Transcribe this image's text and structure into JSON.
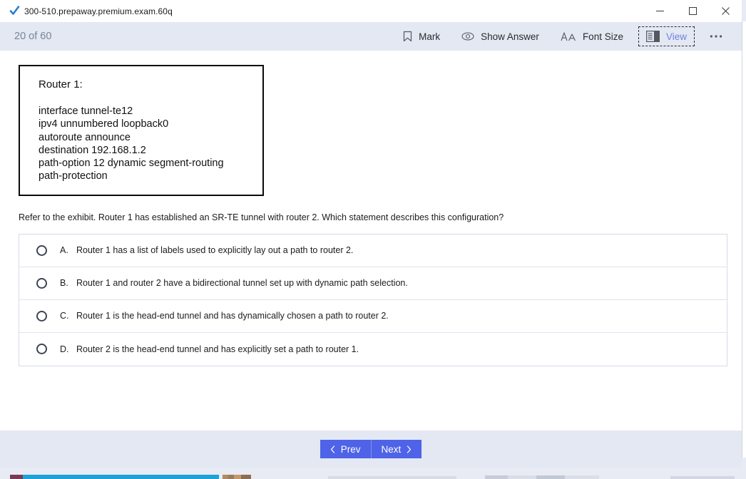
{
  "window": {
    "title": "300-510.prepaway.premium.exam.60q",
    "app_icon": "checkmark-icon",
    "controls": {
      "minimize": "minimize-icon",
      "maximize": "maximize-icon",
      "close": "close-icon"
    }
  },
  "toolbar": {
    "counter": "20 of 60",
    "mark_label": "Mark",
    "show_answer_label": "Show Answer",
    "font_size_label": "Font Size",
    "view_label": "View",
    "more_label": "•••"
  },
  "exhibit": {
    "title": "Router 1:",
    "lines": [
      "interface tunnel-te12",
      "ipv4 unnumbered loopback0",
      "autoroute announce",
      "destination 192.168.1.2",
      "path-option 12 dynamic segment-routing",
      "path-protection"
    ]
  },
  "question": {
    "text": "Refer to the exhibit. Router 1 has established an SR-TE tunnel with router 2. Which statement describes this configuration?",
    "options": [
      {
        "letter": "A.",
        "text": "Router 1 has a list of labels used to explicitly lay out a path to router 2.",
        "selected": false
      },
      {
        "letter": "B.",
        "text": "Router 1 and router 2 have a bidirectional tunnel set up with dynamic path selection.",
        "selected": false
      },
      {
        "letter": "C.",
        "text": "Router 1 is the head-end tunnel and has dynamically chosen a path to router 2.",
        "selected": false
      },
      {
        "letter": "D.",
        "text": "Router 2 is the head-end tunnel and has explicitly set a path to router 1.",
        "selected": false
      }
    ]
  },
  "footer": {
    "prev_label": "Prev",
    "next_label": "Next"
  },
  "colors": {
    "toolbar_bg": "#e3e8f3",
    "nav_button": "#4f63e8",
    "accent_link": "#6f83de",
    "counter_text": "#7b8396",
    "option_border": "#d6dbe8"
  }
}
